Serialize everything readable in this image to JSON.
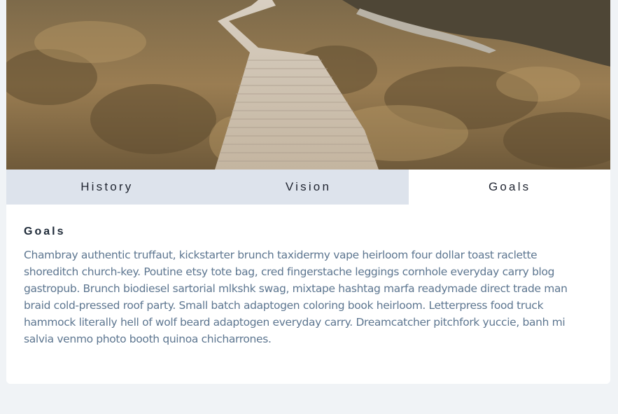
{
  "hero": {
    "image": "boardwalk-through-grassland-photo"
  },
  "tabs": [
    {
      "label": "History",
      "active": false
    },
    {
      "label": "Vision",
      "active": false
    },
    {
      "label": "Goals",
      "active": true
    }
  ],
  "panel": {
    "title": "Goals",
    "body": "Chambray authentic truffaut, kickstarter brunch taxidermy vape heirloom four dollar toast raclette shoreditch church-key. Poutine etsy tote bag, cred fingerstache leggings cornhole everyday carry blog gastropub. Brunch biodiesel sartorial mlkshk swag, mixtape hashtag marfa readymade direct trade man braid cold-pressed roof party. Small batch adaptogen coloring book heirloom. Letterpress food truck hammock literally hell of wolf beard adaptogen everyday carry. Dreamcatcher pitchfork yuccie, banh mi salvia venmo photo booth quinoa chicharrones."
  },
  "colors": {
    "page_bg": "#f0f3f6",
    "tab_inactive_bg": "#dde3ec",
    "tab_active_bg": "#ffffff",
    "body_text": "#5d7690",
    "heading_text": "#1e2a38"
  }
}
